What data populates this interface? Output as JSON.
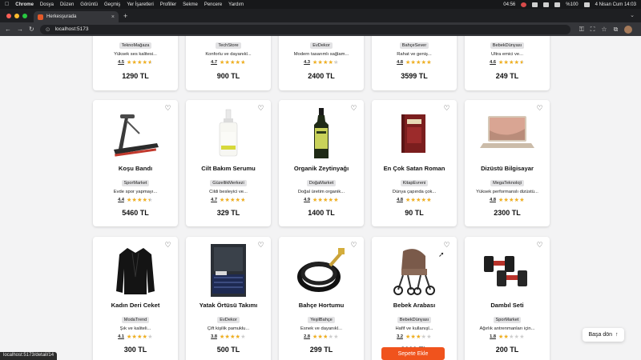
{
  "system_menu": {
    "app_name": "Chrome",
    "items": [
      "Dosya",
      "Düzen",
      "Görüntü",
      "Geçmiş",
      "Yer İşaretleri",
      "Profiller",
      "Sekme",
      "Pencere",
      "Yardım"
    ],
    "time_small": "04:56",
    "battery": "%100",
    "datetime": "4 Nisan Cum  14:03"
  },
  "browser": {
    "tab_title": "Herkesşurada",
    "url": "localhost:5173",
    "status_url": "localhost:5173/detail/14"
  },
  "colors": {
    "accent": "#f0531d",
    "star": "#f2b01e",
    "page_bg": "#f3f3f4"
  },
  "products_row0": [
    {
      "seller": "TeknoMağaza",
      "desc": "Yüksek ses kalitesi...",
      "rating": "4.5",
      "rating_value": 4.5,
      "price": "1290 TL",
      "image": "partial-product"
    },
    {
      "seller": "TechStore",
      "desc": "Konforlu ve dayanıkl...",
      "rating": "4.7",
      "rating_value": 4.7,
      "price": "900 TL",
      "image": "partial-product"
    },
    {
      "seller": "EvDekor",
      "desc": "Modern tasarımlı sağlam...",
      "rating": "4.3",
      "rating_value": 4.3,
      "price": "2400 TL",
      "image": "partial-product"
    },
    {
      "seller": "BahçeSever",
      "desc": "Rahat ve geniş...",
      "rating": "4.8",
      "rating_value": 4.8,
      "price": "3599 TL",
      "image": "partial-product"
    },
    {
      "seller": "BebekDünyası",
      "desc": "Ultra emici ve...",
      "rating": "4.6",
      "rating_value": 4.6,
      "price": "249 TL",
      "image": "partial-product"
    }
  ],
  "products_row1": [
    {
      "title": "Koşu Bandı",
      "seller": "SporMarket",
      "desc": "Evde spor yapmayı...",
      "rating": "4.4",
      "rating_value": 4.4,
      "price": "5460 TL",
      "image": "treadmill"
    },
    {
      "title": "Cilt Bakım Serumu",
      "seller": "GüzellikMerkezi",
      "desc": "Cildi besleyici ve...",
      "rating": "4.7",
      "rating_value": 4.7,
      "price": "329 TL",
      "image": "serum-bottle"
    },
    {
      "title": "Organik Zeytinyağı",
      "seller": "DoğaMarket",
      "desc": "Doğal üretim organik...",
      "rating": "4.9",
      "rating_value": 4.9,
      "price": "1400 TL",
      "image": "olive-oil-bottle"
    },
    {
      "title": "En Çok Satan Roman",
      "seller": "KitapEvreni",
      "desc": "Dünya çapında çok...",
      "rating": "4.8",
      "rating_value": 4.8,
      "price": "90 TL",
      "image": "book"
    },
    {
      "title": "Dizüstü Bilgisayar",
      "seller": "MegaTeknoloji",
      "desc": "Yüksek performanslı dizüstü...",
      "rating": "4.8",
      "rating_value": 4.8,
      "price": "2300 TL",
      "image": "laptop"
    }
  ],
  "products_row2": [
    {
      "title": "Kadın Deri Ceket",
      "seller": "ModaTrend",
      "desc": "Şık ve kaliteli...",
      "rating": "4.1",
      "rating_value": 4.1,
      "price": "300 TL",
      "image": "leather-jacket"
    },
    {
      "title": "Yatak Örtüsü Takımı",
      "seller": "EvDekor",
      "desc": "Çift kişilik pamuklu...",
      "rating": "3.8",
      "rating_value": 3.8,
      "price": "500 TL",
      "image": "bedspread"
    },
    {
      "title": "Bahçe Hortumu",
      "seller": "YeşilBahçe",
      "desc": "Esnek ve dayanıkl...",
      "rating": "2.8",
      "rating_value": 2.8,
      "price": "299 TL",
      "image": "garden-hose"
    },
    {
      "title": "Bebek Arabası",
      "seller": "BebekDünyası",
      "desc": "Hafif ve kullanışl...",
      "rating": "3.2",
      "rating_value": 3.2,
      "price": "3000 TL",
      "image": "stroller"
    },
    {
      "title": "Dambıl Seti",
      "seller": "SporMarket",
      "desc": "Ağırlık antrenmanları için...",
      "rating": "1.8",
      "rating_value": 1.8,
      "price": "200 TL",
      "image": "dumbbells"
    }
  ],
  "add_to_cart_label": "Sepete Ekle",
  "back_to_top_label": "Başa dön",
  "icons": {
    "favorite": "heart-icon",
    "back_to_top": "arrow-up-icon"
  }
}
